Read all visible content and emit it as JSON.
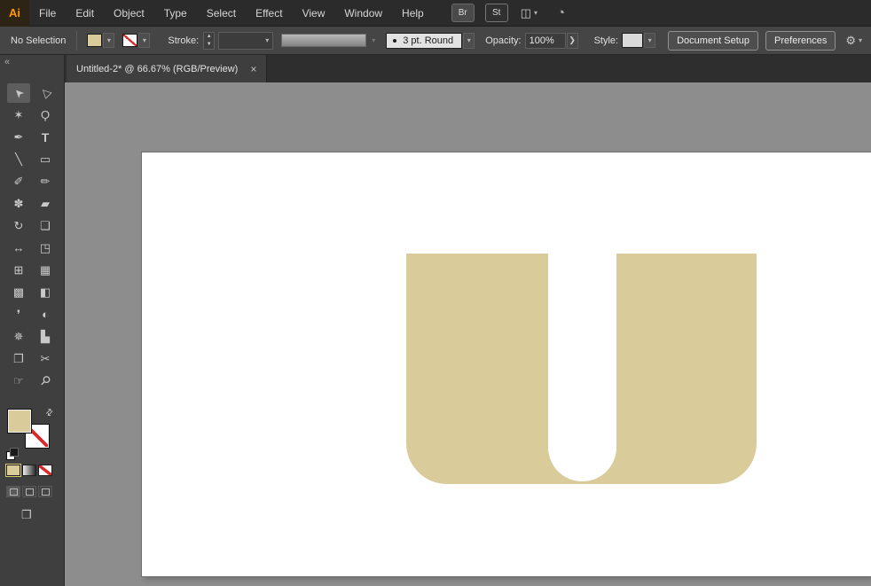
{
  "titlebar": {
    "logo_text": "Ai",
    "menus": [
      "File",
      "Edit",
      "Object",
      "Type",
      "Select",
      "Effect",
      "View",
      "Window",
      "Help"
    ],
    "bridge_button_label": "Br",
    "stock_button_label": "St",
    "workspace_icon_glyph": "◫",
    "sync_icon_glyph": "◔",
    "caret_glyph": "▾"
  },
  "control_bar": {
    "selection_status": "No Selection",
    "stroke_label": "Stroke:",
    "stepper_up": "▲",
    "stepper_down": "▼",
    "brush_name": "3 pt. Round",
    "opacity_label": "Opacity:",
    "opacity_value": "100%",
    "flyout_glyph": "❯",
    "style_label": "Style:",
    "document_setup_label": "Document Setup",
    "preferences_label": "Preferences",
    "tools_icon_glyph": "⚙"
  },
  "document_tab": {
    "title": "Untitled-2* @ 66.67% (RGB/Preview)",
    "close_glyph": "×"
  },
  "toolbar": {
    "collapse_glyph": "«",
    "active_tool": "selection-tool",
    "screen_mode_glyph": "❐",
    "swap_glyph": "⇄",
    "tools": [
      {
        "name": "selection-tool",
        "glyph": "➤"
      },
      {
        "name": "direct-selection-tool",
        "glyph": "▷"
      },
      {
        "name": "magic-wand-tool",
        "glyph": "✶"
      },
      {
        "name": "lasso-tool",
        "glyph": "Ϙ"
      },
      {
        "name": "pen-tool",
        "glyph": "✒"
      },
      {
        "name": "type-tool",
        "glyph": "T"
      },
      {
        "name": "line-segment-tool",
        "glyph": "╲"
      },
      {
        "name": "rectangle-tool",
        "glyph": "▭"
      },
      {
        "name": "paintbrush-tool",
        "glyph": "✐"
      },
      {
        "name": "pencil-tool",
        "glyph": "✏"
      },
      {
        "name": "blob-brush-tool",
        "glyph": "✽"
      },
      {
        "name": "eraser-tool",
        "glyph": "▰"
      },
      {
        "name": "rotate-tool",
        "glyph": "↻"
      },
      {
        "name": "scale-tool",
        "glyph": "❏"
      },
      {
        "name": "width-tool",
        "glyph": "↔"
      },
      {
        "name": "free-transform-tool",
        "glyph": "◳"
      },
      {
        "name": "shape-builder-tool",
        "glyph": "⊞"
      },
      {
        "name": "perspective-grid-tool",
        "glyph": "▦"
      },
      {
        "name": "mesh-tool",
        "glyph": "▩"
      },
      {
        "name": "gradient-tool",
        "glyph": "◧"
      },
      {
        "name": "eyedropper-tool",
        "glyph": "❜"
      },
      {
        "name": "blend-tool",
        "glyph": "◐"
      },
      {
        "name": "symbol-sprayer-tool",
        "glyph": "✵"
      },
      {
        "name": "column-graph-tool",
        "glyph": "▙"
      },
      {
        "name": "artboard-tool",
        "glyph": "❐"
      },
      {
        "name": "slice-tool",
        "glyph": "✂"
      },
      {
        "name": "hand-tool",
        "glyph": "☞"
      },
      {
        "name": "zoom-tool",
        "glyph": "⚲"
      }
    ]
  },
  "canvas": {
    "background_color": "#8D8D8D",
    "artboard_color": "#FFFFFF",
    "shape": {
      "type": "letter-U",
      "fill": "#D9CC9A"
    }
  },
  "colors": {
    "fill_swatch": "#D9CC9A",
    "accent_orange": "#FF9A00",
    "none_red": "#D92B2B"
  }
}
